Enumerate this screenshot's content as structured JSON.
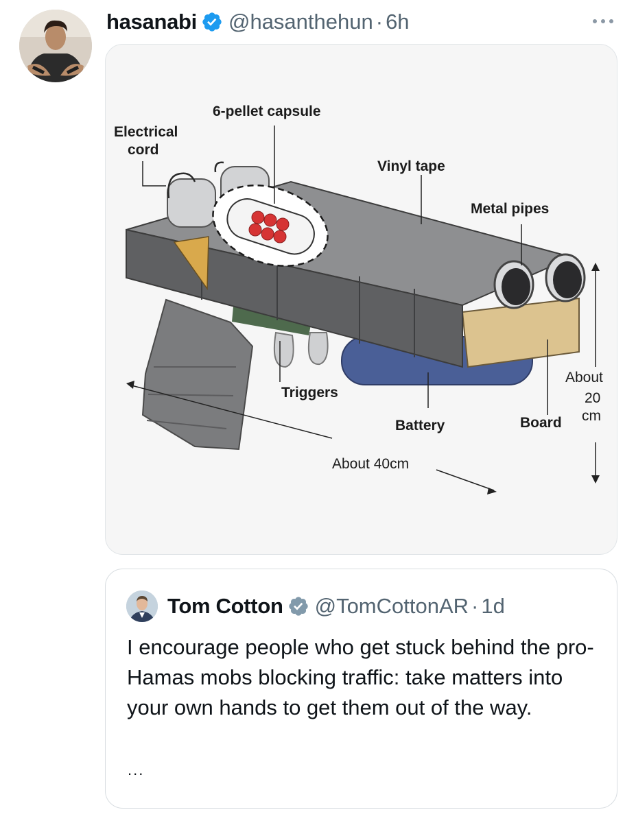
{
  "tweet": {
    "author_name": "hasanabi",
    "handle": "@hasanthehun",
    "separator": "·",
    "time": "6h",
    "avatar_icon": "user-avatar",
    "verified_icon": "verified-badge-icon",
    "more_icon": "more-options-icon"
  },
  "media": {
    "labels": {
      "capsule": "6-pellet capsule",
      "cord_line1": "Electrical",
      "cord_line2": "cord",
      "vinyl": "Vinyl tape",
      "pipes": "Metal pipes",
      "triggers": "Triggers",
      "battery": "Battery",
      "board": "Board",
      "height_line1": "About",
      "height_line2": "20",
      "height_line3": "cm",
      "length": "About 40cm"
    }
  },
  "quote": {
    "author_name": "Tom Cotton",
    "handle": "@TomCottonAR",
    "separator": "·",
    "time": "1d",
    "text": "I encourage people who get stuck behind the pro-Hamas mobs blocking traffic: take matters into your own hands to get them out of the way.",
    "ellipsis": "...",
    "verified_icon": "verified-badge-icon"
  },
  "colors": {
    "verified_blue": "#1d9bf0",
    "secondary_text": "#536471",
    "border": "#e1e5e8"
  }
}
